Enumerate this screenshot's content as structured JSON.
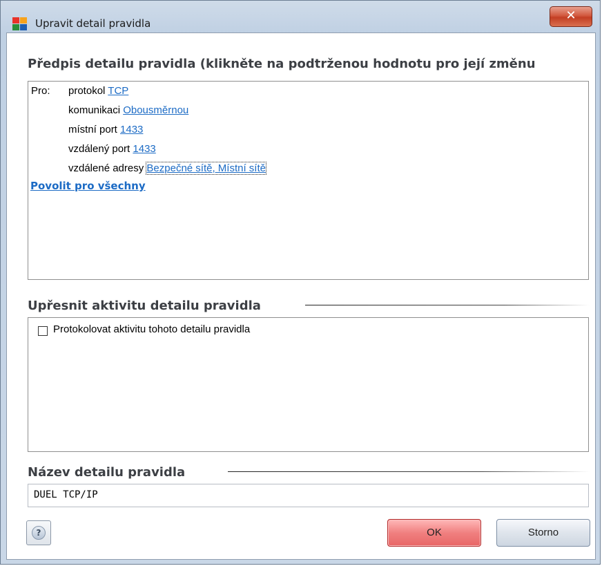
{
  "window": {
    "title": "Upravit detail pravidla",
    "close_glyph": "✕"
  },
  "rule_definition": {
    "heading": "Předpis detailu pravidla (klikněte na podtrženou hodnotu pro její změnu",
    "for_label": "Pro:",
    "protocol_label": "protokol",
    "protocol_value": "TCP",
    "direction_label": "komunikaci",
    "direction_value": "Obousměrnou",
    "local_port_label": "místní port",
    "local_port_value": "1433",
    "remote_port_label": "vzdálený port",
    "remote_port_value": "1433",
    "remote_addr_label": "vzdálené adresy",
    "remote_addr_value": "Bezpečné sítě, Místní sítě",
    "action_link": "Povolit pro všechny"
  },
  "activity": {
    "heading": "Upřesnit aktivitu detailu pravidla",
    "log_checkbox_label": "Protokolovat aktivitu tohoto detailu pravidla",
    "log_checked": false
  },
  "name_section": {
    "heading": "Název detailu pravidla",
    "value": "DUEL TCP/IP"
  },
  "buttons": {
    "help": "?",
    "ok": "OK",
    "cancel": "Storno"
  },
  "colors": {
    "link": "#1c6bc5",
    "ok_button": "#f08080",
    "close_button": "#c33f24"
  }
}
